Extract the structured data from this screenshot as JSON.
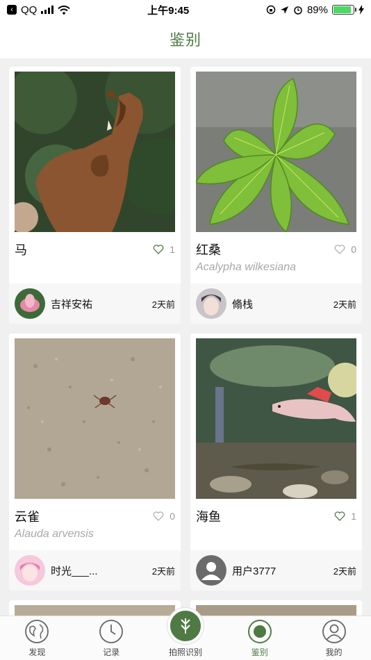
{
  "status": {
    "carrier": "QQ",
    "time": "上午9:45",
    "battery": "89%"
  },
  "header": {
    "title": "鉴别"
  },
  "cards": [
    {
      "title": "马",
      "likes": "1",
      "scientific": "",
      "user": "吉祥安祐",
      "time": "2天前",
      "liked": true
    },
    {
      "title": "红桑",
      "likes": "0",
      "scientific": "Acalypha wilkesiana",
      "user": "翛栈",
      "time": "2天前",
      "liked": false
    },
    {
      "title": "云雀",
      "likes": "0",
      "scientific": "Alauda arvensis",
      "user": "时光___...",
      "time": "2天前",
      "liked": false
    },
    {
      "title": "海鱼",
      "likes": "1",
      "scientific": "",
      "user": "用户3777",
      "time": "2天前",
      "liked": false
    }
  ],
  "tabs": [
    {
      "label": "发现",
      "icon": "globe-icon"
    },
    {
      "label": "记录",
      "icon": "clock-icon"
    },
    {
      "label": "拍照识别",
      "icon": "camera-scan-icon"
    },
    {
      "label": "鉴别",
      "icon": "target-icon",
      "active": true
    },
    {
      "label": "我的",
      "icon": "user-icon"
    }
  ],
  "colors": {
    "accent": "#4f7a44",
    "background": "#f0f0f0"
  }
}
